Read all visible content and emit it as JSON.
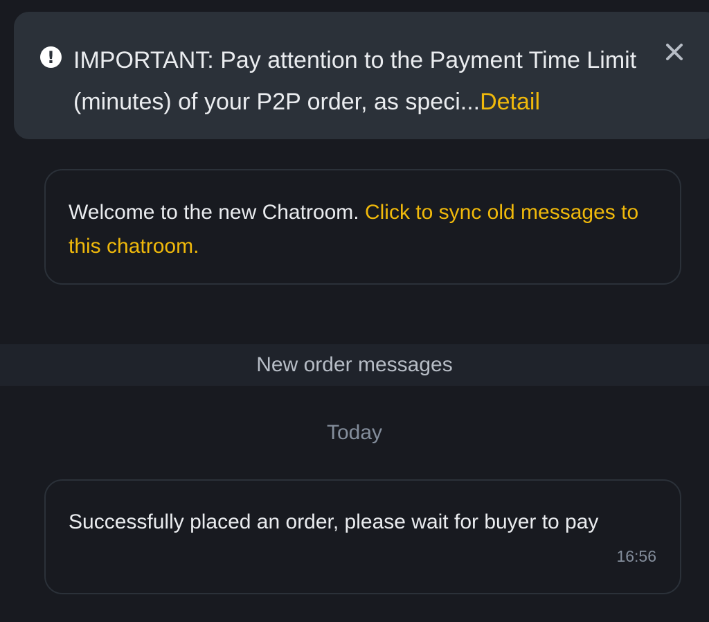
{
  "notice": {
    "prefix": "IMPORTANT: Pay attention to the Payment Time Limit (minutes) of your P2P order, as speci...",
    "link": "Detail",
    "icon": "exclamation-circle-icon",
    "close_icon": "close-icon"
  },
  "welcome": {
    "text": "Welcome to the new Chatroom. ",
    "link": "Click to sync old messages to this chatroom."
  },
  "divider": {
    "label": "New order messages"
  },
  "date_label": "Today",
  "messages": [
    {
      "text": "Successfully placed an order, please wait for buyer to pay",
      "time": "16:56"
    }
  ],
  "colors": {
    "background": "#181a20",
    "notice_bg": "#2b3139",
    "accent": "#f0b90b",
    "text": "#eaecef",
    "muted": "#848e9c"
  }
}
